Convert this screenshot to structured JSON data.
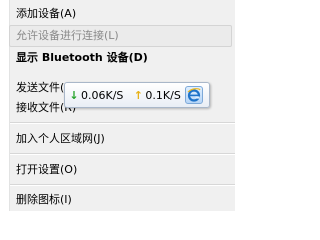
{
  "menu": {
    "items": [
      {
        "label": "添加设备(A)"
      },
      {
        "label": "允许设备进行连接(L)"
      },
      {
        "label": "显示 Bluetooth 设备(D)"
      },
      {
        "label": "发送文件(S)"
      },
      {
        "label": "接收文件(R)"
      },
      {
        "label": "加入个人区域网(J)"
      },
      {
        "label": "打开设置(O)"
      },
      {
        "label": "删除图标(I)"
      }
    ]
  },
  "tooltip": {
    "download_speed": "0.06K/S",
    "upload_speed": "0.1K/S",
    "icon": "ie-icon"
  }
}
